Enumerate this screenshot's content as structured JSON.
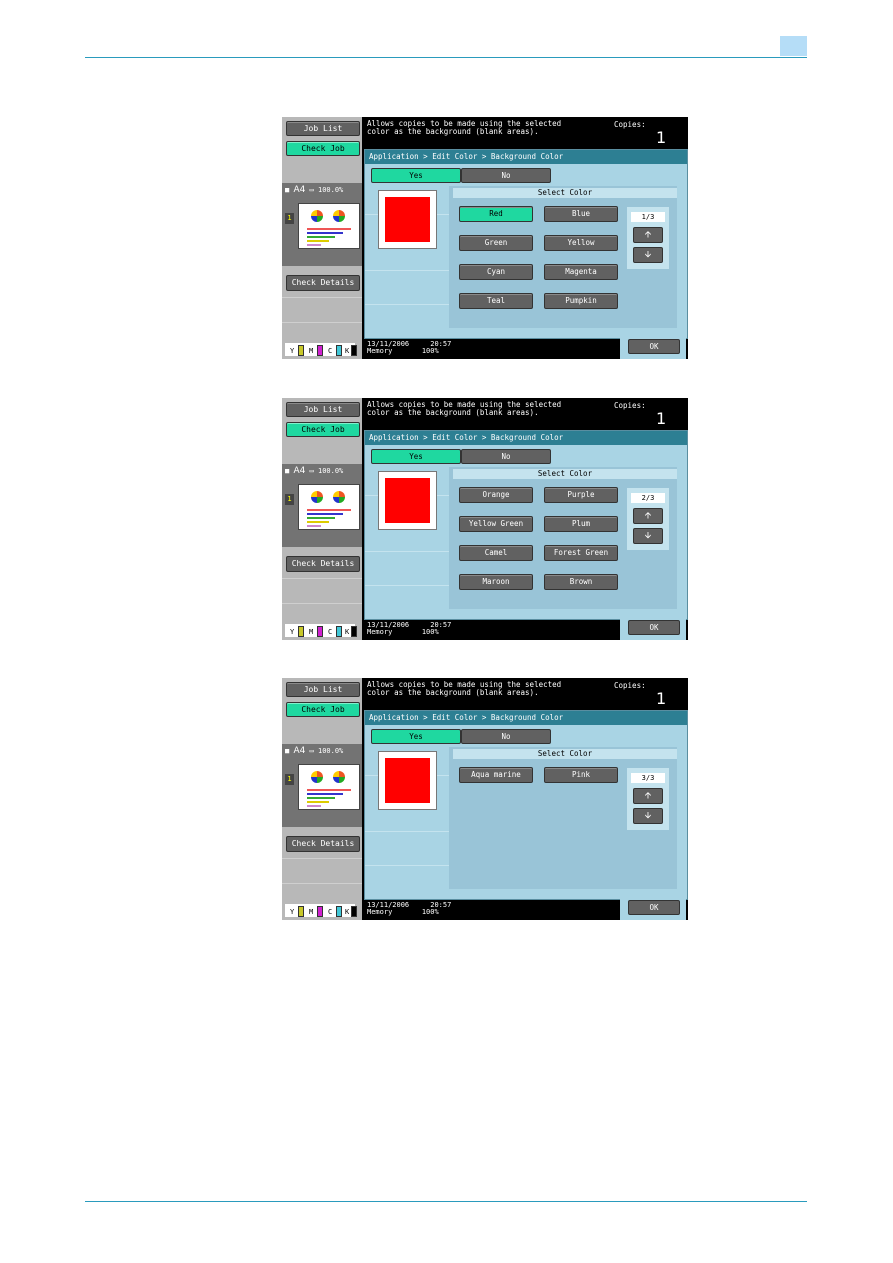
{
  "page": {
    "accent_color": "#2a9bbd"
  },
  "screens": [
    {
      "sidebar": {
        "job_list": "Job List",
        "check_job": "Check Job",
        "check_details": "Check Details",
        "paper": "A4",
        "zoom": "100.0%",
        "page_num": "1",
        "toner": [
          "Y",
          "M",
          "C",
          "K"
        ]
      },
      "message": "Allows copies to be made using the selected\ncolor as the background (blank areas).",
      "copies_label": "Copies:",
      "copies_value": "1",
      "breadcrumb": "Application > Edit Color > Background Color",
      "yes_label": "Yes",
      "no_label": "No",
      "selected_swatch_color": "#ff0000",
      "panel_title": "Select Color",
      "colors": [
        {
          "label": "Red",
          "selected": true
        },
        {
          "label": "Blue",
          "selected": false
        },
        {
          "label": "Green",
          "selected": false
        },
        {
          "label": "Yellow",
          "selected": false
        },
        {
          "label": "Cyan",
          "selected": false
        },
        {
          "label": "Magenta",
          "selected": false
        },
        {
          "label": "Teal",
          "selected": false
        },
        {
          "label": "Pumpkin",
          "selected": false
        }
      ],
      "page_indicator": "1/3",
      "date": "13/11/2006",
      "time": "20:57",
      "memory_label": "Memory",
      "memory_value": "100%",
      "ok_label": "OK"
    },
    {
      "sidebar": {
        "job_list": "Job List",
        "check_job": "Check Job",
        "check_details": "Check Details",
        "paper": "A4",
        "zoom": "100.0%",
        "page_num": "1",
        "toner": [
          "Y",
          "M",
          "C",
          "K"
        ]
      },
      "message": "Allows copies to be made using the selected\ncolor as the background (blank areas).",
      "copies_label": "Copies:",
      "copies_value": "1",
      "breadcrumb": "Application > Edit Color > Background Color",
      "yes_label": "Yes",
      "no_label": "No",
      "selected_swatch_color": "#ff0000",
      "panel_title": "Select Color",
      "colors": [
        {
          "label": "Orange",
          "selected": false
        },
        {
          "label": "Purple",
          "selected": false
        },
        {
          "label": "Yellow Green",
          "selected": false
        },
        {
          "label": "Plum",
          "selected": false
        },
        {
          "label": "Camel",
          "selected": false
        },
        {
          "label": "Forest Green",
          "selected": false
        },
        {
          "label": "Maroon",
          "selected": false
        },
        {
          "label": "Brown",
          "selected": false
        }
      ],
      "page_indicator": "2/3",
      "date": "13/11/2006",
      "time": "20:57",
      "memory_label": "Memory",
      "memory_value": "100%",
      "ok_label": "OK"
    },
    {
      "sidebar": {
        "job_list": "Job List",
        "check_job": "Check Job",
        "check_details": "Check Details",
        "paper": "A4",
        "zoom": "100.0%",
        "page_num": "1",
        "toner": [
          "Y",
          "M",
          "C",
          "K"
        ]
      },
      "message": "Allows copies to be made using the selected\ncolor as the background (blank areas).",
      "copies_label": "Copies:",
      "copies_value": "1",
      "breadcrumb": "Application > Edit Color > Background Color",
      "yes_label": "Yes",
      "no_label": "No",
      "selected_swatch_color": "#ff0000",
      "panel_title": "Select Color",
      "colors": [
        {
          "label": "Aqua marine",
          "selected": false
        },
        {
          "label": "Pink",
          "selected": false
        }
      ],
      "page_indicator": "3/3",
      "date": "13/11/2006",
      "time": "20:57",
      "memory_label": "Memory",
      "memory_value": "100%",
      "ok_label": "OK"
    }
  ]
}
